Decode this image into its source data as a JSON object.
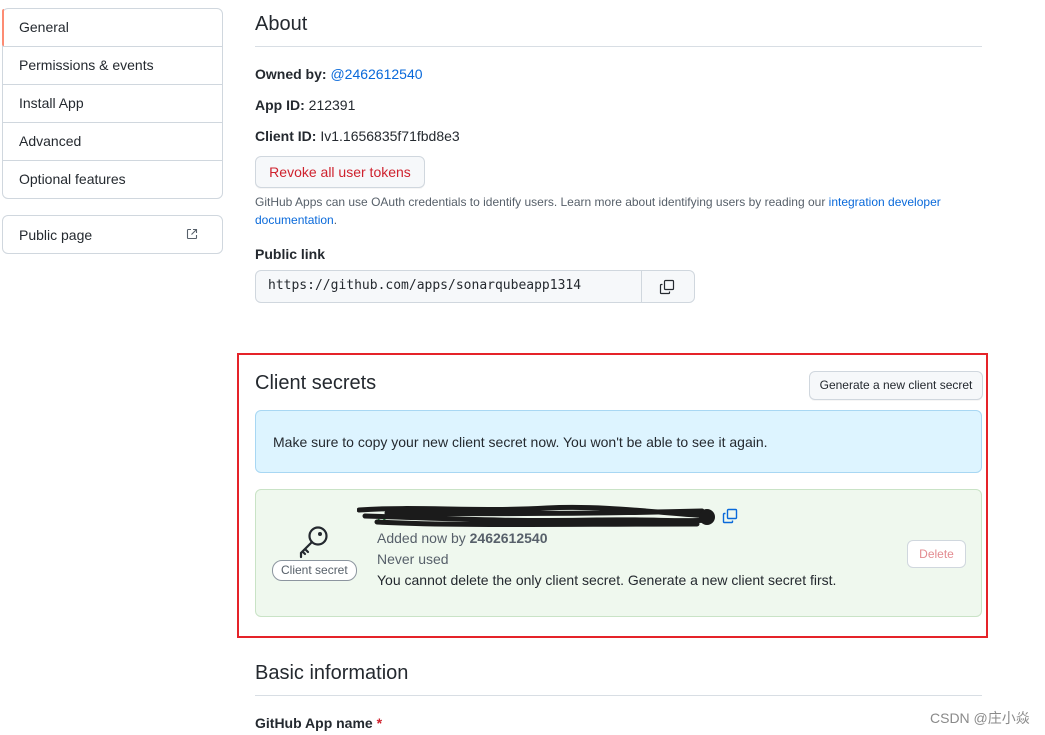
{
  "sidebar": {
    "items": [
      {
        "label": "General",
        "selected": true
      },
      {
        "label": "Permissions & events"
      },
      {
        "label": "Install App"
      },
      {
        "label": "Advanced"
      },
      {
        "label": "Optional features"
      }
    ],
    "public_page": "Public page"
  },
  "about": {
    "title": "About",
    "owned_by_label": "Owned by:",
    "owned_by_value": "@2462612540",
    "app_id_label": "App ID:",
    "app_id_value": "212391",
    "client_id_label": "Client ID:",
    "client_id_value": "Iv1.1656835f71fbd8e3",
    "revoke_button": "Revoke all user tokens",
    "note_text": "GitHub Apps can use OAuth credentials to identify users. Learn more about identifying users by reading our ",
    "note_link": "integration developer documentation",
    "note_end": ".",
    "public_link_label": "Public link",
    "public_link_value": "https://github.com/apps/sonarqubeapp1314"
  },
  "client_secrets": {
    "title": "Client secrets",
    "generate_button": "Generate a new client secret",
    "flash": "Make sure to copy your new client secret now. You won't be able to see it again.",
    "badge": "Client secret",
    "added_prefix": "Added now by ",
    "added_by": "2462612540",
    "never_used": "Never used",
    "cannot_delete": "You cannot delete the only client secret. Generate a new client secret first.",
    "delete_button": "Delete"
  },
  "basic_info": {
    "title": "Basic information",
    "app_name_label": "GitHub App name",
    "required_mark": "*"
  },
  "watermark": "CSDN @庄小焱",
  "colors": {
    "accent_link": "#0969da",
    "danger": "#cf222e",
    "highlight_box": "#e52329",
    "flash_bg": "#ddf4ff",
    "success_bg": "#eff8ee",
    "nav_selected": "#fd8c73"
  }
}
